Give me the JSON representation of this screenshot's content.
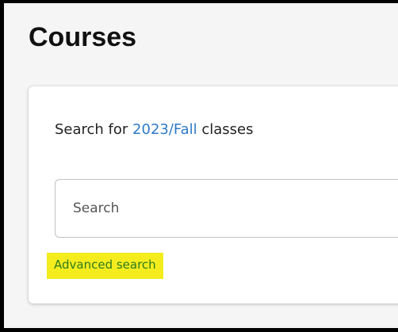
{
  "page": {
    "title": "Courses"
  },
  "search_card": {
    "prefix": "Search for ",
    "term": "2023/Fall",
    "suffix": " classes",
    "search_placeholder": "Search",
    "search_value": "",
    "advanced_search_label": "Advanced search"
  },
  "colors": {
    "term_link": "#2f7ac6",
    "advanced_search_text": "#2e7d1e",
    "advanced_search_highlight": "#f5ec1e"
  }
}
